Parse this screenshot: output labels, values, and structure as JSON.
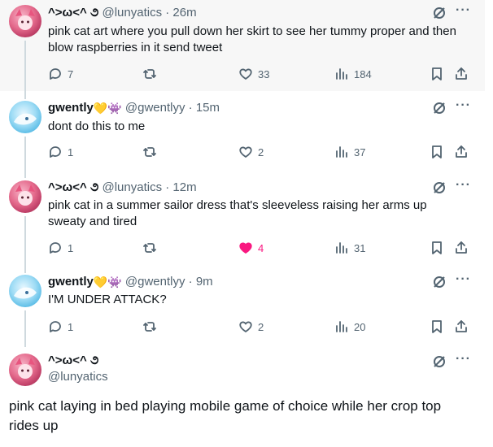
{
  "tweets": [
    {
      "name": "^>ω<^ ૭",
      "handle": "@lunyatics",
      "time": "26m",
      "text": "pink cat art where you pull down her skirt to see her tummy proper and then blow raspberries in it send tweet",
      "replies": "7",
      "likes": "33",
      "views": "184",
      "liked": false
    },
    {
      "name": "gwently",
      "badge_emojis": "💛👾",
      "handle": "@gwentlyy",
      "time": "15m",
      "text": "dont do this to me",
      "replies": "1",
      "likes": "2",
      "views": "37",
      "liked": false
    },
    {
      "name": "^>ω<^ ૭",
      "handle": "@lunyatics",
      "time": "12m",
      "text": "pink cat in a summer sailor dress that's sleeveless raising her arms up sweaty and tired",
      "replies": "1",
      "likes": "4",
      "views": "31",
      "liked": true
    },
    {
      "name": "gwently",
      "badge_emojis": "💛👾",
      "handle": "@gwentlyy",
      "time": "9m",
      "text": "I'M UNDER ATTACK?",
      "replies": "1",
      "likes": "2",
      "views": "20",
      "liked": false
    }
  ],
  "main_tweet": {
    "name": "^>ω<^ ૭",
    "handle": "@lunyatics",
    "text": "pink cat laying in bed playing mobile game of choice while her crop top rides up"
  },
  "separator": "·",
  "colors": {
    "like_active": "#f91880",
    "muted": "#536471",
    "highlight_bg": "#f7f7f7"
  }
}
